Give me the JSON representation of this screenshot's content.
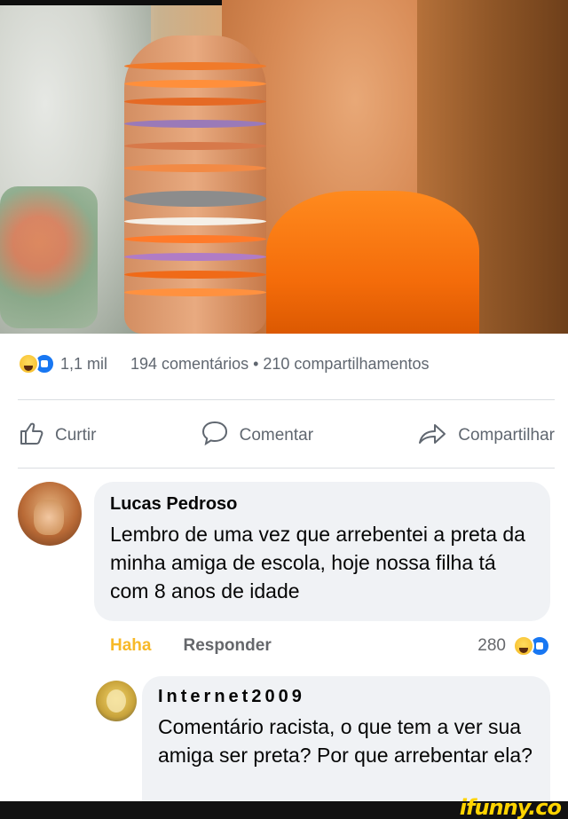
{
  "post": {
    "reactions": {
      "count": "1,1 mil",
      "icons": [
        "haha-icon",
        "like-icon"
      ]
    },
    "stats": "194 comentários • 210 compartilhamentos",
    "actions": {
      "like": "Curtir",
      "comment": "Comentar",
      "share": "Compartilhar"
    }
  },
  "comments": [
    {
      "author": "Lucas Pedroso",
      "text": "Lembro de uma vez que arrebentei a preta da minha amiga de escola, hoje nossa filha tá com 8 anos de idade",
      "reaction_label": "Haha",
      "reply_label": "Responder",
      "reaction_count": "280"
    },
    {
      "author": "Internet2009",
      "text": "Comentário racista, o que tem a ver sua amiga ser preta? Por que arrebentar ela?"
    }
  ],
  "watermark": "ifunny.co",
  "colors": {
    "haha_yellow": "#f7b928",
    "like_blue": "#1877f2",
    "bubble_bg": "#f0f2f5",
    "muted_text": "#606770"
  }
}
